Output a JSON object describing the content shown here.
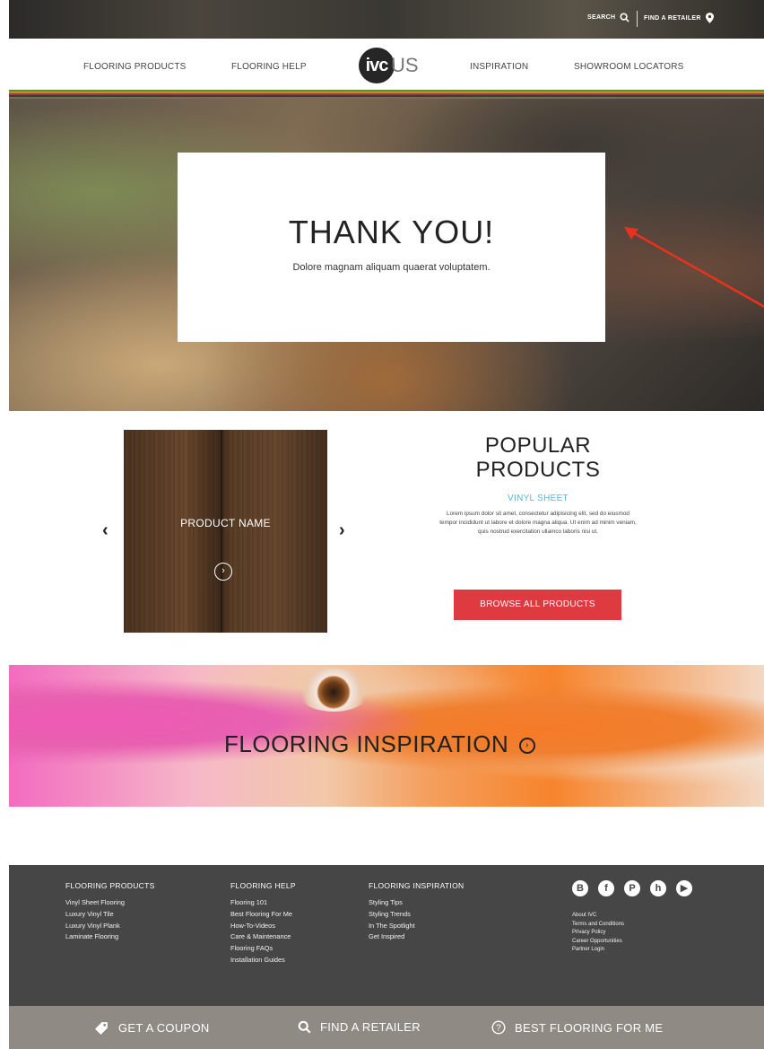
{
  "topbar": {
    "search_label": "SEARCH",
    "retailer_label": "FIND A RETAILER"
  },
  "nav": {
    "items": [
      "FLOORING PRODUCTS",
      "FLOORING HELP",
      "INSPIRATION",
      "SHOWROOM LOCATORS"
    ],
    "logo_mark": "ivc",
    "logo_suffix": "US"
  },
  "brand_stripes": [
    "#5a8c3a",
    "#c78b2a",
    "#9e3b33",
    "#3b3b3b",
    "#7a6a56"
  ],
  "hero": {
    "title": "THANK YOU!",
    "subtitle": "Dolore magnam aliquam quaerat voluptatem."
  },
  "products": {
    "product_name": "PRODUCT NAME",
    "heading_line1": "POPULAR",
    "heading_line2": "PRODUCTS",
    "category": "VINYL SHEET",
    "description": "Lorem ipsum dolor sit amet, consectetur adipisicing elit, sed do eiusmod tempor incididunt ut labore et dolore magna aliqua. Ut enim ad minim veniam, quis nostrud exercitation ullamco laboris nisi ut.",
    "browse_label": "BROWSE ALL PRODUCTS",
    "prev_glyph": "‹",
    "next_glyph": "›"
  },
  "inspiration": {
    "title": "FLOORING INSPIRATION"
  },
  "footer": {
    "columns": [
      {
        "heading": "FLOORING PRODUCTS",
        "links": [
          "Vinyl Sheet Flooring",
          "Luxury Vinyl Tile",
          "Luxury Vinyl Plank",
          "Laminate Flooring"
        ]
      },
      {
        "heading": "FLOORING HELP",
        "links": [
          "Flooring 101",
          "Best Flooring For Me",
          "How-To-Videos",
          "Care & Maintenance",
          "Flooring FAQs",
          "Installation Guides"
        ]
      },
      {
        "heading": "FLOORING INSPIRATION",
        "links": [
          "Styling Tips",
          "Styling Trends",
          "In The Spotlight",
          "Get Inspired"
        ]
      }
    ],
    "social_icons": [
      "blogger-icon",
      "facebook-icon",
      "pinterest-icon",
      "houzz-icon",
      "youtube-icon"
    ],
    "company_links": [
      "About IVC",
      "Terms and Conditions",
      "Privacy Policy",
      "Career Opportunities",
      "Partner Login"
    ]
  },
  "bottombar": {
    "coupon_label": "GET A COUPON",
    "retailer_label": "FIND A  RETAILER",
    "best_label": "BEST FLOORING FOR ME"
  },
  "colors": {
    "accent_red": "#de3a3f",
    "accent_blue": "#5db3d6",
    "footer_bg": "#464646",
    "bottombar_bg": "#8f8a84"
  }
}
